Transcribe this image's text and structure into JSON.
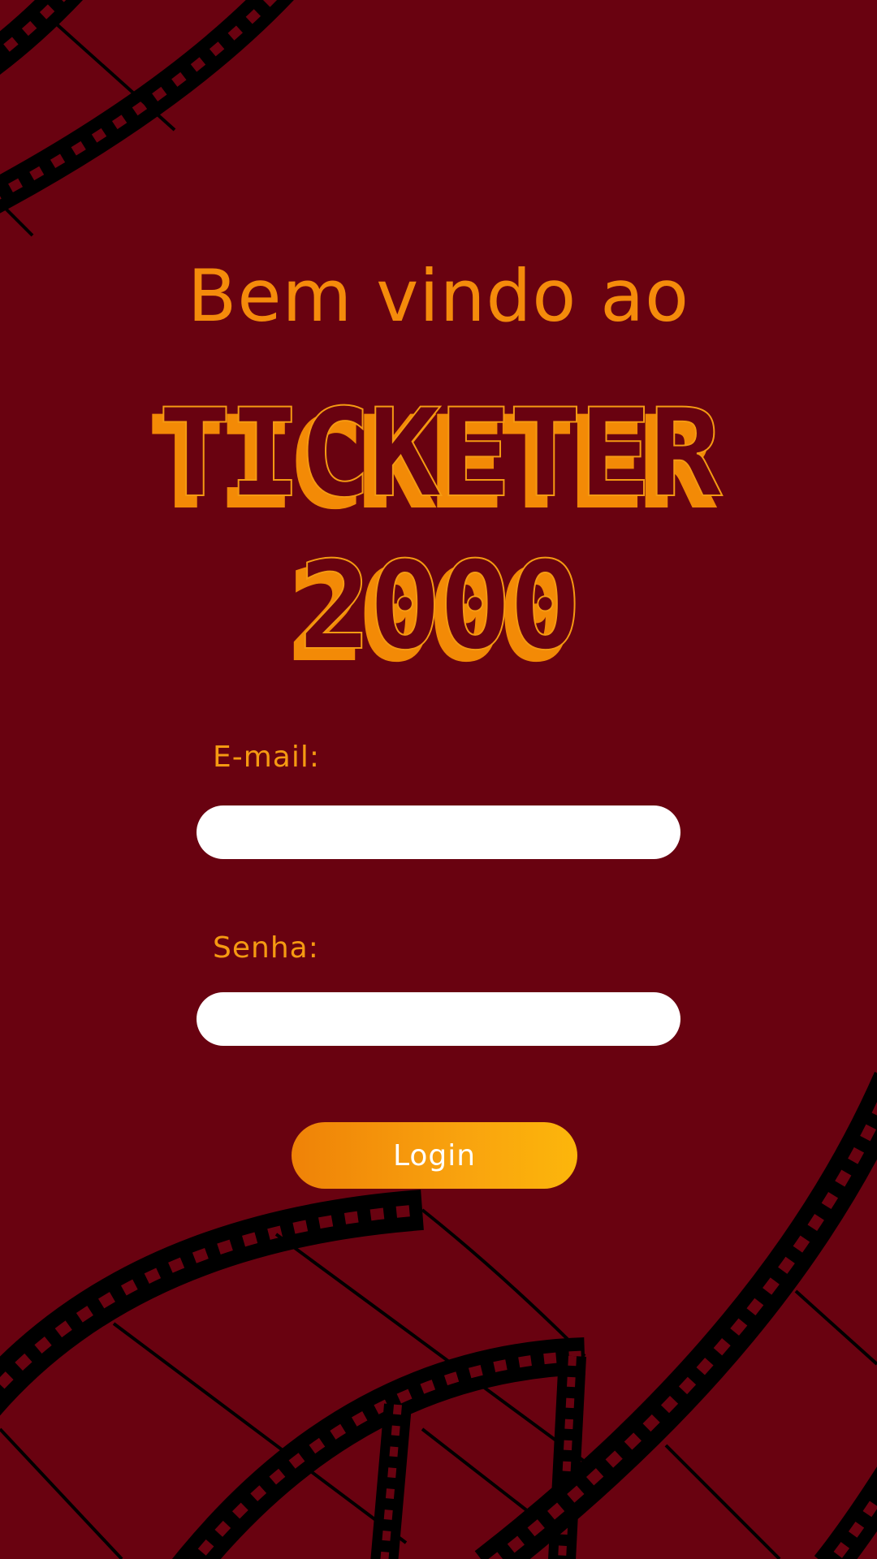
{
  "welcome_text": "Bem vindo ao",
  "logo": {
    "line1": "TICKETER",
    "line2": "2000"
  },
  "form": {
    "email_label": "E-mail:",
    "email_value": "",
    "password_label": "Senha:",
    "password_value": "",
    "login_label": "Login"
  },
  "colors": {
    "background": "#690210",
    "accent": "#f58b0b",
    "button_gradient_start": "#ef8207",
    "button_gradient_end": "#fcb60b",
    "input_background": "#ffffff"
  },
  "decorations": [
    "film-strip-top-left",
    "film-strip-bottom-left",
    "film-strip-bottom-center",
    "film-strip-bottom-right"
  ]
}
